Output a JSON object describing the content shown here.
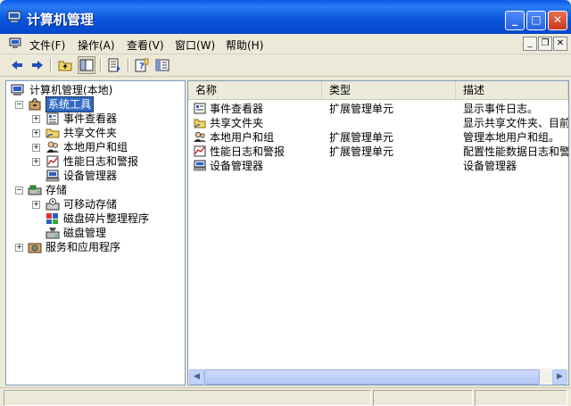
{
  "window": {
    "title": "计算机管理"
  },
  "colors": {
    "titlebar": "#0a58e8",
    "selection": "#316ac5",
    "pane_border": "#7f9db9"
  },
  "menu": {
    "items": [
      "文件(F)",
      "操作(A)",
      "查看(V)",
      "窗口(W)",
      "帮助(H)"
    ]
  },
  "toolbar": {
    "buttons": [
      "back-arrow-icon",
      "forward-arrow-icon",
      "up-folder-icon",
      "show-hide-tree-icon",
      "export-list-icon",
      "help-icon",
      "properties-icon"
    ]
  },
  "tree": {
    "root": "计算机管理(本地)",
    "system_tools": "系统工具",
    "event_viewer": "事件查看器",
    "shared_folders": "共享文件夹",
    "local_users": "本地用户和组",
    "perf_logs": "性能日志和警报",
    "device_manager": "设备管理器",
    "storage": "存储",
    "removable": "可移动存储",
    "defrag": "磁盘碎片整理程序",
    "disk_mgmt": "磁盘管理",
    "services": "服务和应用程序"
  },
  "list": {
    "columns": [
      "名称",
      "类型",
      "描述"
    ],
    "rows": [
      {
        "name": "事件查看器",
        "type": "扩展管理单元",
        "desc": "显示事件日志。"
      },
      {
        "name": "共享文件夹",
        "type": "",
        "desc": "显示共享文件夹、目前"
      },
      {
        "name": "本地用户和组",
        "type": "扩展管理单元",
        "desc": "管理本地用户和组。"
      },
      {
        "name": "性能日志和警报",
        "type": "扩展管理单元",
        "desc": "配置性能数据日志和警"
      },
      {
        "name": "设备管理器",
        "type": "",
        "desc": "设备管理器"
      }
    ]
  }
}
